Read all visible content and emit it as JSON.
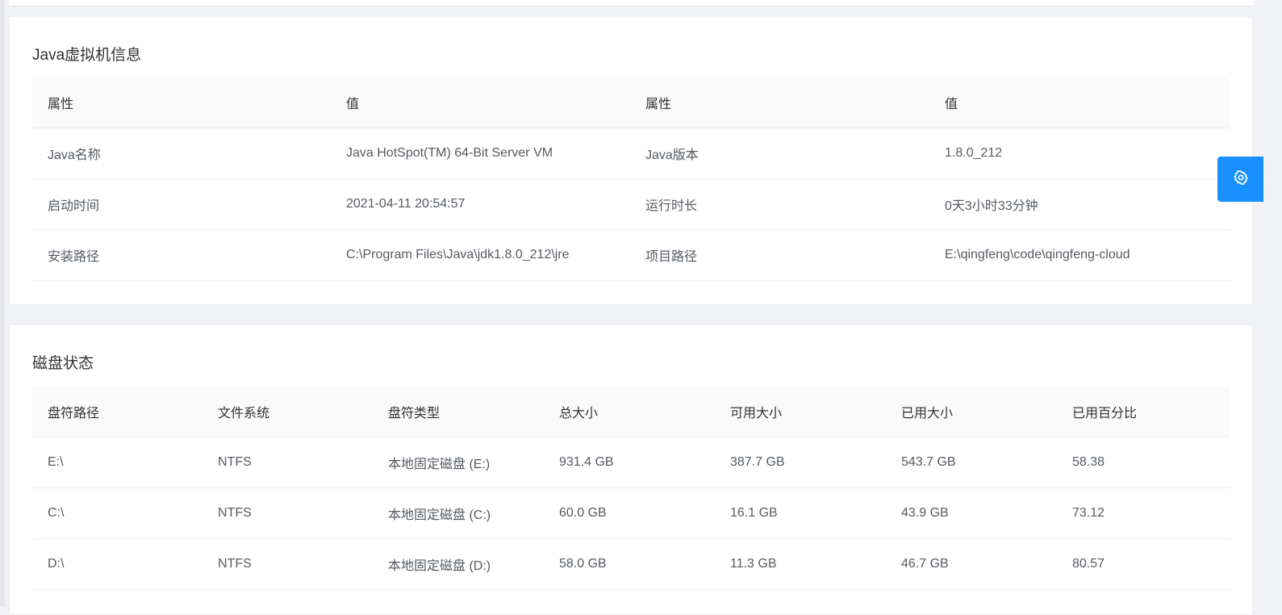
{
  "jvm": {
    "title": "Java虚拟机信息",
    "headers": [
      "属性",
      "值",
      "属性",
      "值"
    ],
    "rows": [
      [
        "Java名称",
        "Java HotSpot(TM) 64-Bit Server VM",
        "Java版本",
        "1.8.0_212"
      ],
      [
        "启动时间",
        "2021-04-11 20:54:57",
        "运行时长",
        "0天3小时33分钟"
      ],
      [
        "安装路径",
        "C:\\Program Files\\Java\\jdk1.8.0_212\\jre",
        "项目路径",
        "E:\\qingfeng\\code\\qingfeng-cloud"
      ]
    ]
  },
  "disk": {
    "title": "磁盘状态",
    "headers": [
      "盘符路径",
      "文件系统",
      "盘符类型",
      "总大小",
      "可用大小",
      "已用大小",
      "已用百分比"
    ],
    "rows": [
      [
        "E:\\",
        "NTFS",
        "本地固定磁盘 (E:)",
        "931.4 GB",
        "387.7 GB",
        "543.7 GB",
        "58.38"
      ],
      [
        "C:\\",
        "NTFS",
        "本地固定磁盘 (C:)",
        "60.0 GB",
        "16.1 GB",
        "43.9 GB",
        "73.12"
      ],
      [
        "D:\\",
        "NTFS",
        "本地固定磁盘 (D:)",
        "58.0 GB",
        "11.3 GB",
        "46.7 GB",
        "80.57"
      ]
    ]
  },
  "settings": {
    "icon": "gear-icon",
    "color": "#1890ff"
  }
}
